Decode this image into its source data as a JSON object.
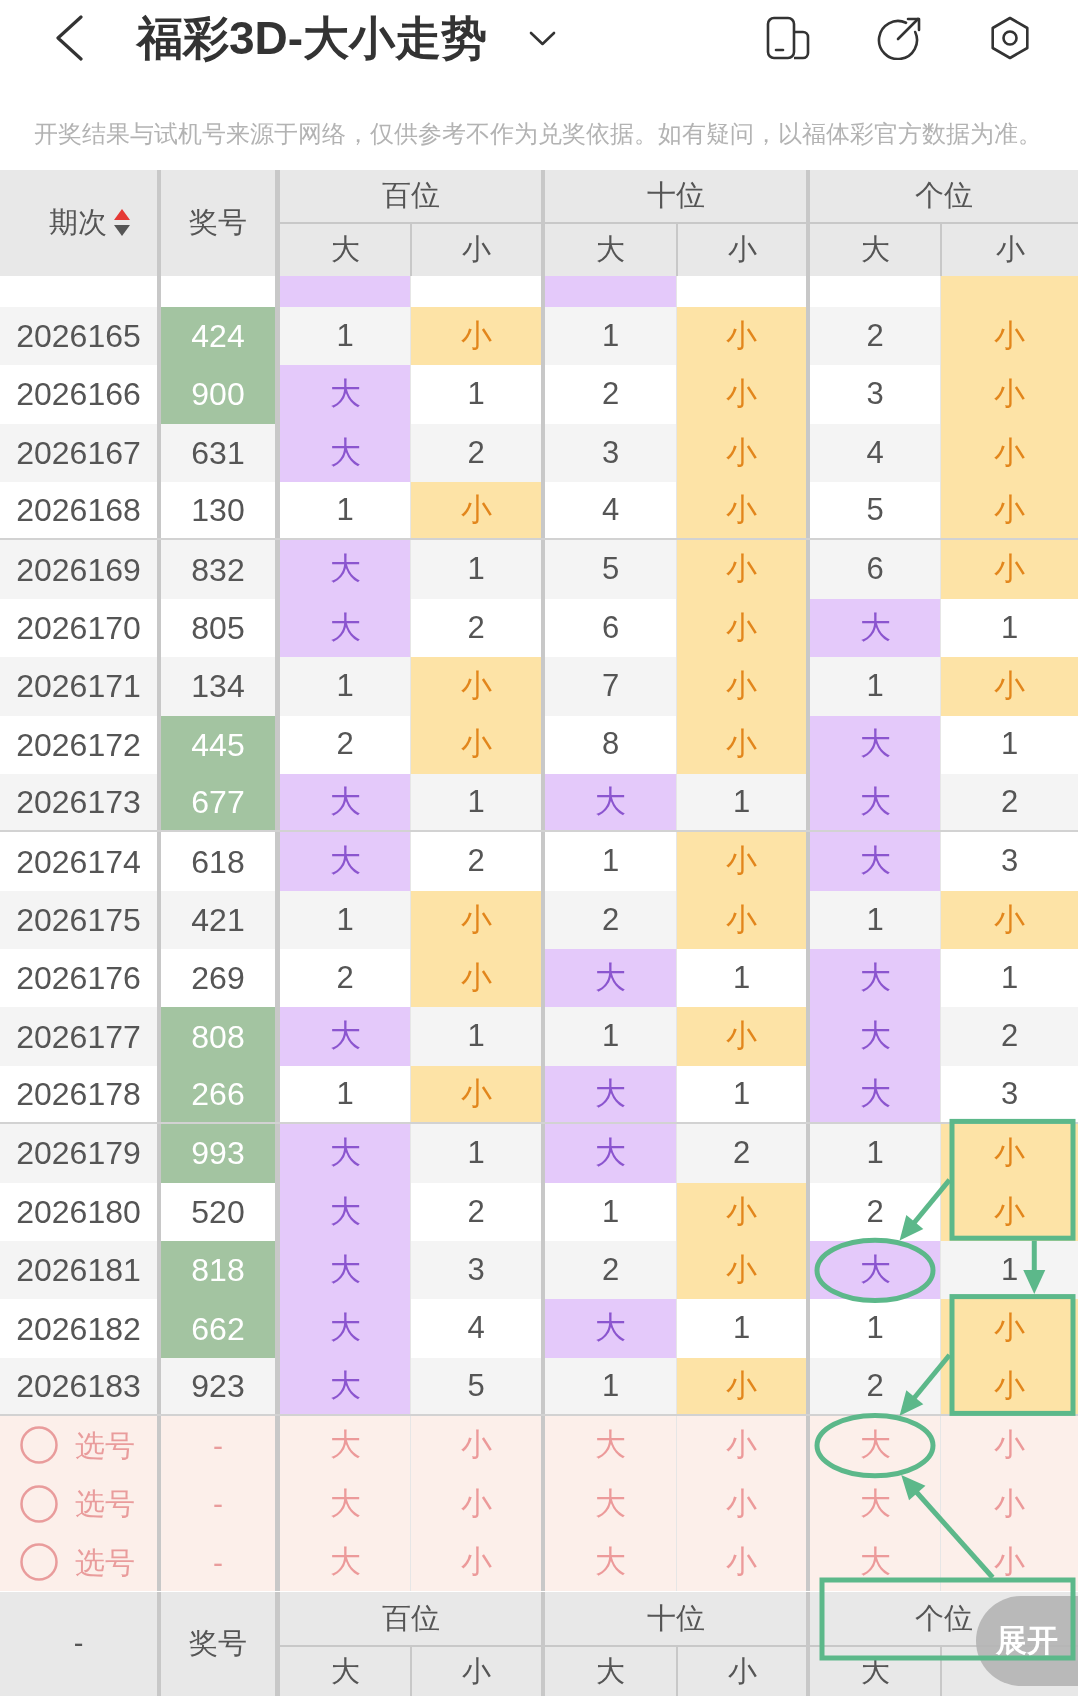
{
  "topbar": {
    "title": "福彩3D-大小走势"
  },
  "notice": "开奖结果与试机号来源于网络，仅供参考不作为兑奖依据。如有疑问，以福体彩官方数据为准。",
  "header": {
    "period": "期次",
    "sorted": true,
    "number": "奖号",
    "groups": [
      {
        "label": "百位",
        "subcolumns": [
          "大",
          "小"
        ]
      },
      {
        "label": "十位",
        "subcolumns": [
          "大",
          "小"
        ]
      },
      {
        "label": "个位",
        "subcolumns": [
          "大",
          "小"
        ]
      }
    ]
  },
  "rows": [
    {
      "highlighted": false,
      "cells": [
        {
          "hit": true
        },
        {
          "hit": false
        },
        {
          "hit": true
        },
        {
          "hit": false
        },
        {
          "hit": false
        },
        {
          "hit": true
        }
      ]
    },
    {
      "period": "2026165",
      "number": "424",
      "highlighted": true,
      "cells": [
        {
          "text": "1",
          "hit": false
        },
        {
          "text": "小",
          "hit": true
        },
        {
          "text": "1",
          "hit": false
        },
        {
          "text": "小",
          "hit": true
        },
        {
          "text": "2",
          "hit": false
        },
        {
          "text": "小",
          "hit": true
        }
      ]
    },
    {
      "period": "2026166",
      "number": "900",
      "highlighted": true,
      "cells": [
        {
          "text": "大",
          "hit": true
        },
        {
          "text": "1",
          "hit": false
        },
        {
          "text": "2",
          "hit": false
        },
        {
          "text": "小",
          "hit": true
        },
        {
          "text": "3",
          "hit": false
        },
        {
          "text": "小",
          "hit": true
        }
      ]
    },
    {
      "period": "2026167",
      "number": "631",
      "highlighted": false,
      "cells": [
        {
          "text": "大",
          "hit": true
        },
        {
          "text": "2",
          "hit": false
        },
        {
          "text": "3",
          "hit": false
        },
        {
          "text": "小",
          "hit": true
        },
        {
          "text": "4",
          "hit": false
        },
        {
          "text": "小",
          "hit": true
        }
      ]
    },
    {
      "period": "2026168",
      "number": "130",
      "highlighted": false,
      "cells": [
        {
          "text": "1",
          "hit": false
        },
        {
          "text": "小",
          "hit": true
        },
        {
          "text": "4",
          "hit": false
        },
        {
          "text": "小",
          "hit": true
        },
        {
          "text": "5",
          "hit": false
        },
        {
          "text": "小",
          "hit": true
        }
      ]
    },
    {
      "period": "2026169",
      "number": "832",
      "highlighted": false,
      "cells": [
        {
          "text": "大",
          "hit": true
        },
        {
          "text": "1",
          "hit": false
        },
        {
          "text": "5",
          "hit": false
        },
        {
          "text": "小",
          "hit": true
        },
        {
          "text": "6",
          "hit": false
        },
        {
          "text": "小",
          "hit": true
        }
      ]
    },
    {
      "period": "2026170",
      "number": "805",
      "highlighted": false,
      "cells": [
        {
          "text": "大",
          "hit": true
        },
        {
          "text": "2",
          "hit": false
        },
        {
          "text": "6",
          "hit": false
        },
        {
          "text": "小",
          "hit": true
        },
        {
          "text": "大",
          "hit": true
        },
        {
          "text": "1",
          "hit": false
        }
      ]
    },
    {
      "period": "2026171",
      "number": "134",
      "highlighted": false,
      "cells": [
        {
          "text": "1",
          "hit": false
        },
        {
          "text": "小",
          "hit": true
        },
        {
          "text": "7",
          "hit": false
        },
        {
          "text": "小",
          "hit": true
        },
        {
          "text": "1",
          "hit": false
        },
        {
          "text": "小",
          "hit": true
        }
      ]
    },
    {
      "period": "2026172",
      "number": "445",
      "highlighted": true,
      "cells": [
        {
          "text": "2",
          "hit": false
        },
        {
          "text": "小",
          "hit": true
        },
        {
          "text": "8",
          "hit": false
        },
        {
          "text": "小",
          "hit": true
        },
        {
          "text": "大",
          "hit": true
        },
        {
          "text": "1",
          "hit": false
        }
      ]
    },
    {
      "period": "2026173",
      "number": "677",
      "highlighted": true,
      "cells": [
        {
          "text": "大",
          "hit": true
        },
        {
          "text": "1",
          "hit": false
        },
        {
          "text": "大",
          "hit": true
        },
        {
          "text": "1",
          "hit": false
        },
        {
          "text": "大",
          "hit": true
        },
        {
          "text": "2",
          "hit": false
        }
      ]
    },
    {
      "period": "2026174",
      "number": "618",
      "highlighted": false,
      "cells": [
        {
          "text": "大",
          "hit": true
        },
        {
          "text": "2",
          "hit": false
        },
        {
          "text": "1",
          "hit": false
        },
        {
          "text": "小",
          "hit": true
        },
        {
          "text": "大",
          "hit": true
        },
        {
          "text": "3",
          "hit": false
        }
      ]
    },
    {
      "period": "2026175",
      "number": "421",
      "highlighted": false,
      "cells": [
        {
          "text": "1",
          "hit": false
        },
        {
          "text": "小",
          "hit": true
        },
        {
          "text": "2",
          "hit": false
        },
        {
          "text": "小",
          "hit": true
        },
        {
          "text": "1",
          "hit": false
        },
        {
          "text": "小",
          "hit": true
        }
      ]
    },
    {
      "period": "2026176",
      "number": "269",
      "highlighted": false,
      "cells": [
        {
          "text": "2",
          "hit": false
        },
        {
          "text": "小",
          "hit": true
        },
        {
          "text": "大",
          "hit": true
        },
        {
          "text": "1",
          "hit": false
        },
        {
          "text": "大",
          "hit": true
        },
        {
          "text": "1",
          "hit": false
        }
      ]
    },
    {
      "period": "2026177",
      "number": "808",
      "highlighted": true,
      "cells": [
        {
          "text": "大",
          "hit": true
        },
        {
          "text": "1",
          "hit": false
        },
        {
          "text": "1",
          "hit": false
        },
        {
          "text": "小",
          "hit": true
        },
        {
          "text": "大",
          "hit": true
        },
        {
          "text": "2",
          "hit": false
        }
      ]
    },
    {
      "period": "2026178",
      "number": "266",
      "highlighted": true,
      "cells": [
        {
          "text": "1",
          "hit": false
        },
        {
          "text": "小",
          "hit": true
        },
        {
          "text": "大",
          "hit": true
        },
        {
          "text": "1",
          "hit": false
        },
        {
          "text": "大",
          "hit": true
        },
        {
          "text": "3",
          "hit": false
        }
      ]
    },
    {
      "period": "2026179",
      "number": "993",
      "highlighted": true,
      "cells": [
        {
          "text": "大",
          "hit": true
        },
        {
          "text": "1",
          "hit": false
        },
        {
          "text": "大",
          "hit": true
        },
        {
          "text": "2",
          "hit": false
        },
        {
          "text": "1",
          "hit": false
        },
        {
          "text": "小",
          "hit": true,
          "boxed": true,
          "arrow_to_ring": true,
          "arrow_to_box": true
        }
      ]
    },
    {
      "period": "2026180",
      "number": "520",
      "highlighted": false,
      "cells": [
        {
          "text": "大",
          "hit": true
        },
        {
          "text": "2",
          "hit": false
        },
        {
          "text": "1",
          "hit": false
        },
        {
          "text": "小",
          "hit": true
        },
        {
          "text": "2",
          "hit": false
        },
        {
          "text": "小",
          "hit": true,
          "boxed": true
        }
      ]
    },
    {
      "period": "2026181",
      "number": "818",
      "highlighted": true,
      "cells": [
        {
          "text": "大",
          "hit": true
        },
        {
          "text": "3",
          "hit": false
        },
        {
          "text": "2",
          "hit": false
        },
        {
          "text": "小",
          "hit": true
        },
        {
          "text": "大",
          "hit": true,
          "circled": true
        },
        {
          "text": "1",
          "hit": false
        }
      ]
    },
    {
      "period": "2026182",
      "number": "662",
      "highlighted": true,
      "cells": [
        {
          "text": "大",
          "hit": true
        },
        {
          "text": "4",
          "hit": false
        },
        {
          "text": "大",
          "hit": true
        },
        {
          "text": "1",
          "hit": false
        },
        {
          "text": "1",
          "hit": false
        },
        {
          "text": "小",
          "hit": true,
          "boxed": true,
          "arrow_to_ring": true
        }
      ]
    },
    {
      "period": "2026183",
      "number": "923",
      "highlighted": false,
      "cells": [
        {
          "text": "大",
          "hit": true
        },
        {
          "text": "5",
          "hit": false
        },
        {
          "text": "1",
          "hit": false
        },
        {
          "text": "小",
          "hit": true
        },
        {
          "text": "2",
          "hit": false
        },
        {
          "text": "小",
          "hit": true,
          "boxed": true
        }
      ]
    }
  ],
  "picks": [
    {
      "label": "选号",
      "checked": false,
      "number": "-",
      "options": [
        {
          "text": "大",
          "selected": false
        },
        {
          "text": "小",
          "selected": false
        },
        {
          "text": "大",
          "selected": false
        },
        {
          "text": "小",
          "selected": false
        },
        {
          "text": "大",
          "selected": false,
          "circled": true
        },
        {
          "text": "小",
          "selected": false
        }
      ]
    },
    {
      "label": "选号",
      "checked": false,
      "number": "-",
      "options": [
        {
          "text": "大",
          "selected": false
        },
        {
          "text": "小",
          "selected": false
        },
        {
          "text": "大",
          "selected": false
        },
        {
          "text": "小",
          "selected": false
        },
        {
          "text": "大",
          "selected": false
        },
        {
          "text": "小",
          "selected": false
        }
      ]
    },
    {
      "label": "选号",
      "checked": false,
      "number": "-",
      "options": [
        {
          "text": "大",
          "selected": false
        },
        {
          "text": "小",
          "selected": false
        },
        {
          "text": "大",
          "selected": false
        },
        {
          "text": "小",
          "selected": false
        },
        {
          "text": "大",
          "selected": false
        },
        {
          "text": "小",
          "selected": false
        }
      ]
    }
  ],
  "footer": {
    "period": "-",
    "number": "奖号",
    "groups": [
      {
        "label": "百位",
        "subcolumns": [
          "大",
          "小"
        ]
      },
      {
        "label": "十位",
        "subcolumns": [
          "大",
          "小"
        ]
      },
      {
        "label": "个位",
        "subcolumns": [
          "大"
        ],
        "boxed": true,
        "arrow_to_ring": true
      }
    ]
  },
  "expand_button": "展开"
}
